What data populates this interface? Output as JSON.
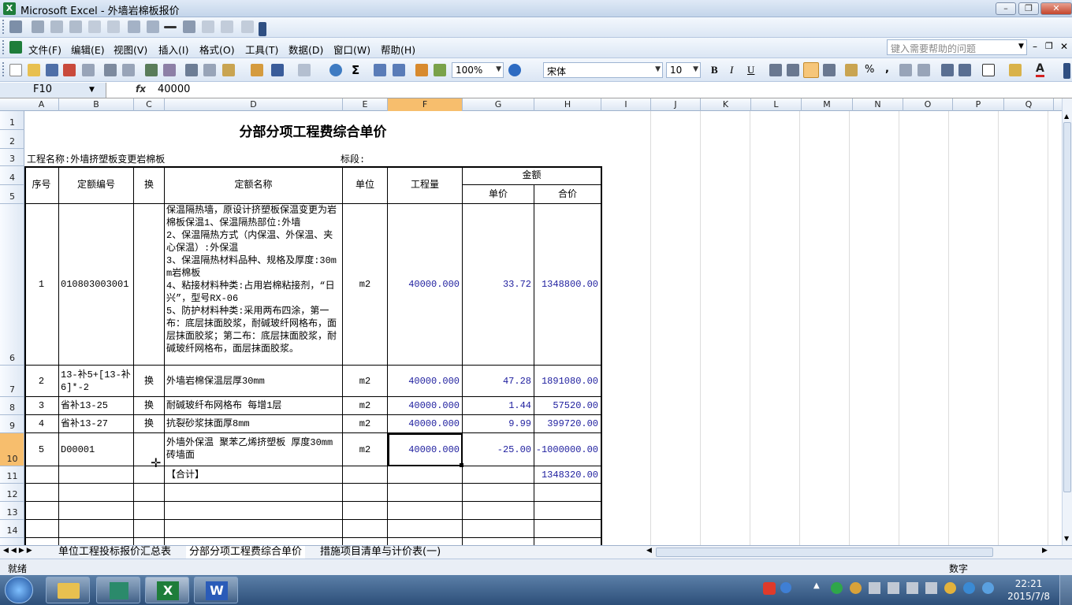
{
  "window": {
    "app_title": "Microsoft Excel - 外墙岩棉板报价"
  },
  "menu": [
    "文件(F)",
    "编辑(E)",
    "视图(V)",
    "插入(I)",
    "格式(O)",
    "工具(T)",
    "数据(D)",
    "窗口(W)",
    "帮助(H)"
  ],
  "help_placeholder": "键入需要帮助的问题",
  "toolbar": {
    "zoom": "100%",
    "font": "宋体",
    "size": "10"
  },
  "formula": {
    "cell": "F10",
    "fx": "fx",
    "value": "40000"
  },
  "columns": [
    "A",
    "B",
    "C",
    "D",
    "E",
    "F",
    "G",
    "H",
    "I",
    "J",
    "K",
    "L",
    "M",
    "N",
    "O",
    "P",
    "Q"
  ],
  "rows": [
    "1",
    "2",
    "3",
    "4",
    "5",
    "6",
    "7",
    "8",
    "9",
    "10",
    "11",
    "12",
    "13",
    "14"
  ],
  "sheet": {
    "title": "分部分项工程费综合单价",
    "project": "工程名称:外墙挤塑板变更岩棉板",
    "section": "标段:",
    "hdr_no": "序号",
    "hdr_code": "定额编号",
    "hdr_swap": "换",
    "hdr_name": "定额名称",
    "hdr_unit": "单位",
    "hdr_qty": "工程量",
    "hdr_amount": "金额",
    "hdr_price": "单价",
    "hdr_total": "合价",
    "items": [
      {
        "no": "1",
        "code": "010803003001",
        "swap": "",
        "name": "保温隔热墙，原设计挤塑板保温变更为岩棉板保温1、保温隔热部位:外墙\n2、保温隔热方式（内保温、外保温、夹心保温）:外保温\n3、保温隔热材料品种、规格及厚度:30mm岩棉板\n4、粘接材料种类:占用岩棉粘接剂，“日兴”，型号RX-06\n5、防护材料种类:采用两布四涂，第一布：底层抹面胶浆，耐碱玻纤网格布，面层抹面胶浆；第二布：底层抹面胶浆，耐碱玻纤网格布，面层抹面胶浆。",
        "unit": "m2",
        "qty": "40000.000",
        "price": "33.72",
        "total": "1348800.00"
      },
      {
        "no": "2",
        "code": "13-补5+[13-补6]*-2",
        "swap": "换",
        "name": "外墙岩棉保温层厚30mm",
        "unit": "m2",
        "qty": "40000.000",
        "price": "47.28",
        "total": "1891080.00"
      },
      {
        "no": "3",
        "code": "省补13-25",
        "swap": "换",
        "name": "耐碱玻纤布网格布 每增1层",
        "unit": "m2",
        "qty": "40000.000",
        "price": "1.44",
        "total": "57520.00"
      },
      {
        "no": "4",
        "code": "省补13-27",
        "swap": "换",
        "name": "抗裂砂浆抹面厚8mm",
        "unit": "m2",
        "qty": "40000.000",
        "price": "9.99",
        "total": "399720.00"
      },
      {
        "no": "5",
        "code": "D00001",
        "swap": "",
        "name": "外墙外保温 聚苯乙烯挤塑板 厚度30mm 砖墙面",
        "unit": "m2",
        "qty": "40000.000",
        "price": "-25.00",
        "total": "-1000000.00"
      }
    ],
    "sum_label": "【合计】",
    "sum_total": "1348320.00"
  },
  "tabs": [
    "单位工程投标报价汇总表",
    "分部分项工程费综合单价",
    "措施项目清单与计价表(一)"
  ],
  "status": {
    "ready": "就绪",
    "mode": "数字"
  },
  "clock": {
    "time": "22:21",
    "date": "2015/7/8"
  }
}
